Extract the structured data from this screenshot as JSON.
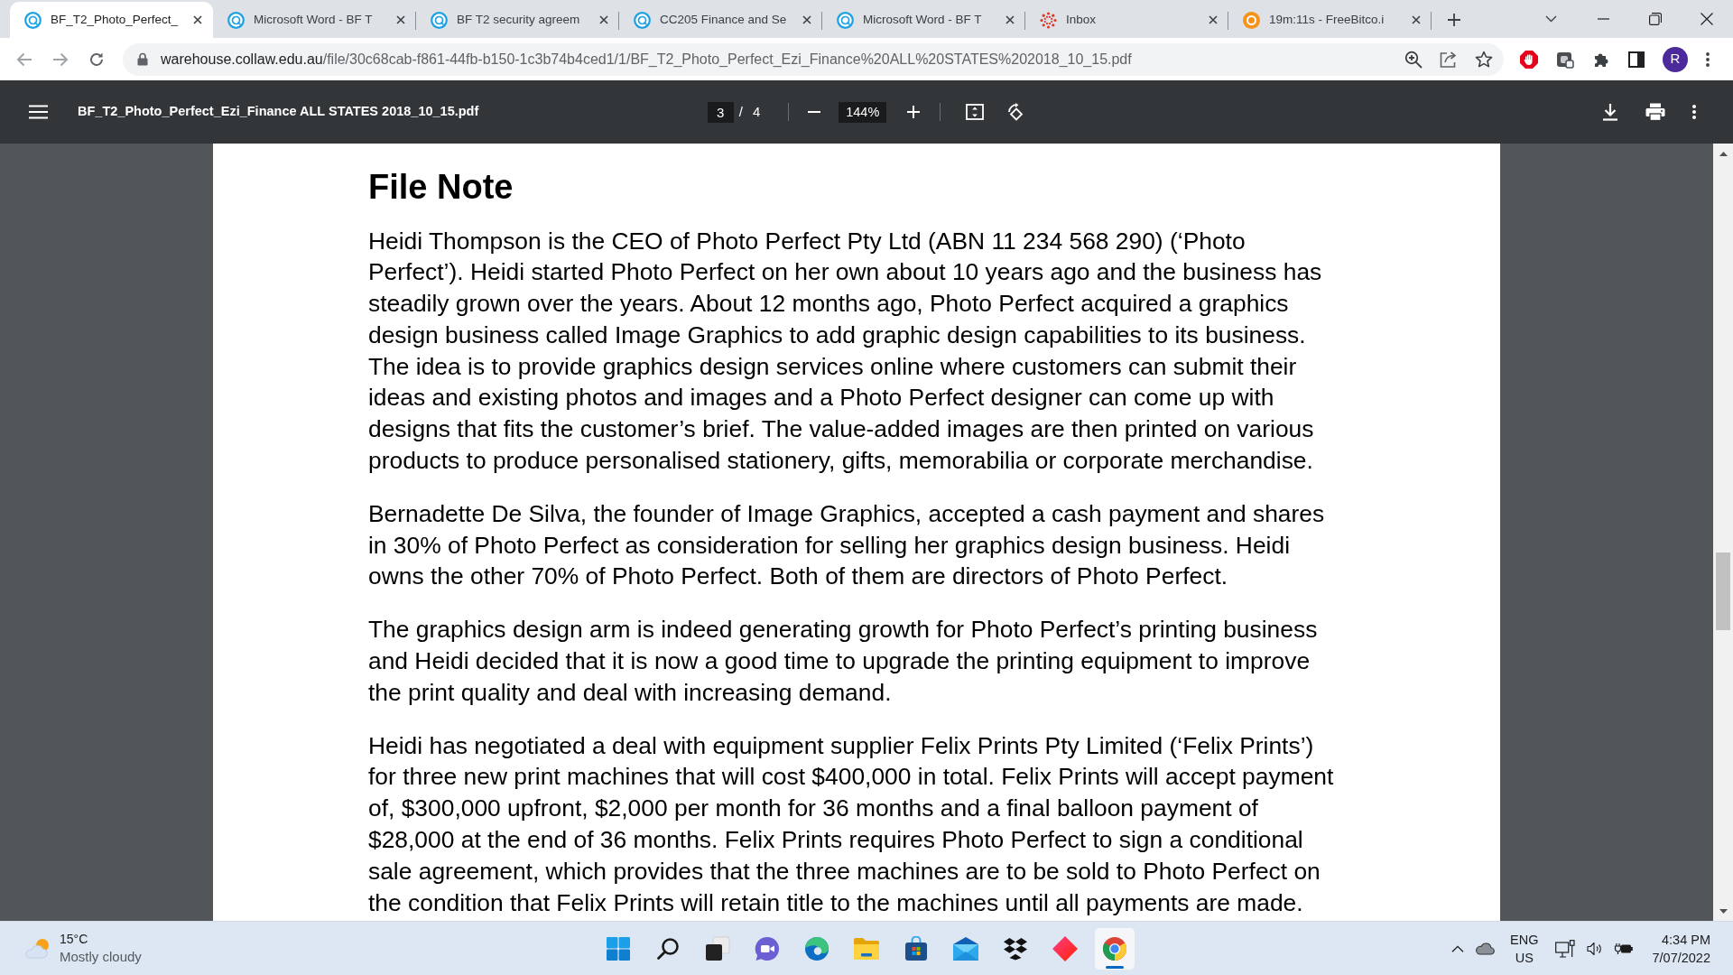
{
  "browser": {
    "tabs": [
      {
        "kind": "ring",
        "title": "BF_T2_Photo_Perfect_",
        "selected": true
      },
      {
        "kind": "ring",
        "title": "Microsoft Word - BF T",
        "selected": false
      },
      {
        "kind": "ring",
        "title": "BF T2 security agreem",
        "selected": false
      },
      {
        "kind": "ring",
        "title": "CC205 Finance and Se",
        "selected": false
      },
      {
        "kind": "ring",
        "title": "Microsoft Word - BF T",
        "selected": false
      },
      {
        "kind": "dots",
        "title": "Inbox",
        "selected": false
      },
      {
        "kind": "coin",
        "title": "19m:11s - FreeBitco.i",
        "selected": false
      }
    ],
    "address_bar": {
      "host": "warehouse.collaw.edu.au",
      "path": "/file/30c68cab-f861-44fb-b150-1c3b74b4ced1/1/BF_T2_Photo_Perfect_Ezi_Finance%20ALL%20STATES%202018_10_15.pdf"
    },
    "profile_initial": "R"
  },
  "pdf_viewer": {
    "file_name": "BF_T2_Photo_Perfect_Ezi_Finance ALL STATES 2018_10_15.pdf",
    "page_number": "3",
    "page_separator": "/",
    "page_count": "4",
    "zoom": "144%"
  },
  "document": {
    "heading": "File Note",
    "paragraphs": [
      "Heidi Thompson is the CEO of Photo Perfect Pty Ltd (ABN 11 234 568 290) (‘Photo Perfect’). Heidi started Photo Perfect on her own about 10 years ago and the business has steadily grown over the years. About 12 months ago, Photo Perfect acquired a graphics design business called Image Graphics to add graphic design capabilities to its business. The idea is to provide graphics design services online where customers can submit their ideas and existing photos and images and a Photo Perfect designer can come up with designs that fits the customer’s brief. The value-added images are then printed on various products to produce personalised stationery, gifts, memorabilia or corporate merchandise.",
      "Bernadette De Silva, the founder of Image Graphics, accepted a cash payment and shares in 30% of Photo Perfect as consideration for selling her graphics design business. Heidi owns the other 70% of Photo Perfect. Both of them are directors of Photo Perfect.",
      "The graphics design arm is indeed generating growth for Photo Perfect’s printing business and Heidi decided that it is now a good time to upgrade the printing equipment to improve the print quality and deal with increasing demand.",
      "Heidi has negotiated a deal with equipment supplier Felix Prints Pty Limited (‘Felix Prints’) for three new print machines that will cost $400,000 in total. Felix Prints will accept payment of, $300,000 upfront, $2,000 per month for 36 months and a final balloon payment of $28,000 at the end of 36 months. Felix Prints requires Photo Perfect to sign a conditional sale agreement, which provides that the three machines are to be sold to Photo Perfect on the condition that Felix Prints will retain title to the machines until all payments are made."
    ]
  },
  "taskbar": {
    "weather": {
      "temperature": "15°C",
      "condition": "Mostly cloudy"
    },
    "apps": [
      {
        "kind": "start",
        "active": false
      },
      {
        "kind": "search",
        "active": false
      },
      {
        "kind": "task-view",
        "active": false
      },
      {
        "kind": "chat",
        "active": false
      },
      {
        "kind": "swirl",
        "active": false
      },
      {
        "kind": "folder",
        "active": false
      },
      {
        "kind": "bag",
        "active": false
      },
      {
        "kind": "envelope",
        "active": false
      },
      {
        "kind": "boxes",
        "active": false
      },
      {
        "kind": "diamond",
        "active": false
      },
      {
        "kind": "tricolor",
        "active": true
      }
    ],
    "tray": {
      "language": "ENG",
      "region": "US",
      "time": "4:34 PM",
      "date": "7/07/2022"
    }
  }
}
